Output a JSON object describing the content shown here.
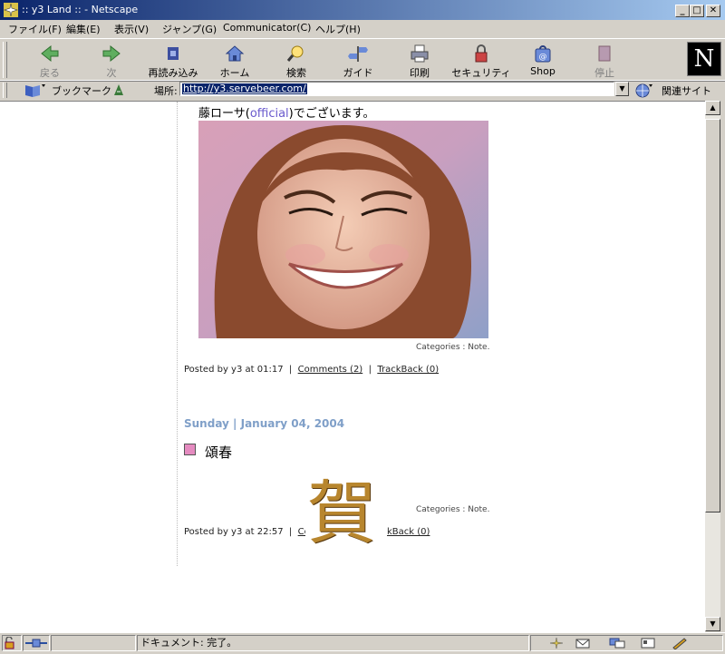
{
  "window": {
    "title": ":: y3 Land :: - Netscape",
    "minimize": "_",
    "maximize": "□",
    "close": "✕"
  },
  "menu": [
    "ファイル(F)",
    "編集(E)",
    "表示(V)",
    "ジャンプ(G)",
    "Communicator(C)",
    "ヘルプ(H)"
  ],
  "toolbar": {
    "back": "戻る",
    "forward": "次",
    "reload": "再読み込み",
    "home": "ホーム",
    "search": "検索",
    "guide": "ガイド",
    "print": "印刷",
    "security": "セキュリティ",
    "shop": "Shop",
    "stop": "停止",
    "brand": "N"
  },
  "location": {
    "bookmarks": "ブックマーク",
    "label": "場所:",
    "url": "http://y3.servebeer.com/",
    "related": "関連サイト"
  },
  "post1": {
    "text_before": "藤ローサ(",
    "link": "official",
    "text_after": ")でございます。",
    "categories": "Categories : Note.",
    "posted_by": "Posted by y3 at 01:17",
    "comments": "Comments (2)",
    "trackback": "TrackBack (0)"
  },
  "post2": {
    "date": "Sunday | January 04, 2004",
    "title": "頌春",
    "image_char": "賀",
    "categories": "Categories : Note.",
    "posted_by": "Posted by y3 at 22:57",
    "comments_partial": "Co",
    "trackback_partial": "kBack (0)"
  },
  "status": {
    "text": "ドキュメント: 完了。"
  },
  "colors": {
    "titlebar": "#0a246a",
    "date_header": "#7f9fc8",
    "title_square": "#e58bc0",
    "link": "#6a5acd"
  }
}
